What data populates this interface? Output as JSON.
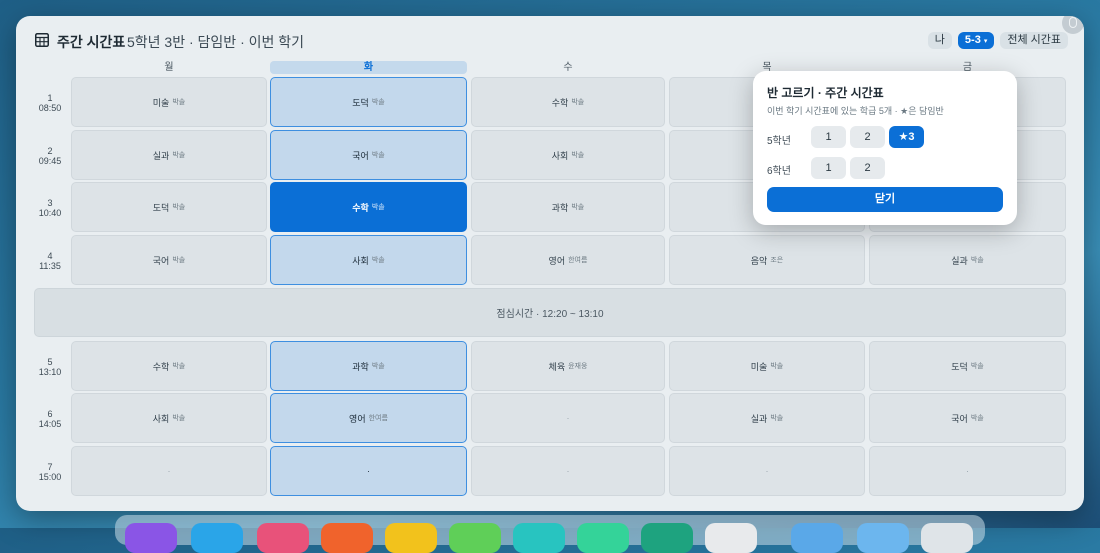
{
  "header": {
    "title": "주간 시간표",
    "subtitle": "5학년 3반 · 담임반 · 이번 학기",
    "me_label": "나",
    "class_label": "5-3",
    "class_caret": "▾",
    "all_label": "전체 시간표"
  },
  "days": [
    "월",
    "화",
    "수",
    "목",
    "금"
  ],
  "periods": [
    {
      "num": "1",
      "time": "08:50"
    },
    {
      "num": "2",
      "time": "09:45"
    },
    {
      "num": "3",
      "time": "10:40"
    },
    {
      "num": "4",
      "time": "11:35"
    },
    {
      "num": "5",
      "time": "13:10"
    },
    {
      "num": "6",
      "time": "14:05"
    },
    {
      "num": "7",
      "time": "15:00"
    }
  ],
  "lunch": "점심시간 · 12:20 ~ 13:10",
  "grid": [
    [
      {
        "s": "미술",
        "t": "박솔"
      },
      {
        "s": "도덕",
        "t": "박솔"
      },
      {
        "s": "수학",
        "t": "박솔"
      },
      {
        "s": "",
        "t": ""
      },
      {
        "s": "",
        "t": ""
      }
    ],
    [
      {
        "s": "실과",
        "t": "박솔"
      },
      {
        "s": "국어",
        "t": "박솔"
      },
      {
        "s": "사회",
        "t": "박솔"
      },
      {
        "s": "",
        "t": ""
      },
      {
        "s": "",
        "t": ""
      }
    ],
    [
      {
        "s": "도덕",
        "t": "박솔"
      },
      {
        "s": "수학",
        "t": "박솔"
      },
      {
        "s": "과학",
        "t": "박솔"
      },
      {
        "s": "",
        "t": ""
      },
      {
        "s": "",
        "t": ""
      }
    ],
    [
      {
        "s": "국어",
        "t": "박솔"
      },
      {
        "s": "사회",
        "t": "박솔"
      },
      {
        "s": "영어",
        "t": "한여름"
      },
      {
        "s": "음악",
        "t": "조은"
      },
      {
        "s": "실과",
        "t": "박솔"
      }
    ],
    [
      {
        "s": "수학",
        "t": "박솔"
      },
      {
        "s": "과학",
        "t": "박솔"
      },
      {
        "s": "체육",
        "t": "윤재웅"
      },
      {
        "s": "미술",
        "t": "박솔"
      },
      {
        "s": "도덕",
        "t": "박솔"
      }
    ],
    [
      {
        "s": "사회",
        "t": "박솔"
      },
      {
        "s": "영어",
        "t": "한여름"
      },
      {
        "s": "·",
        "t": ""
      },
      {
        "s": "실과",
        "t": "박솔"
      },
      {
        "s": "국어",
        "t": "박솔"
      }
    ],
    [
      {
        "s": "·",
        "t": ""
      },
      {
        "s": "·",
        "t": ""
      },
      {
        "s": "·",
        "t": ""
      },
      {
        "s": "·",
        "t": ""
      },
      {
        "s": "·",
        "t": ""
      }
    ]
  ],
  "popup": {
    "title": "반 고르기 · 주간 시간표",
    "subtitle": "이번 학기 시간표에 있는 학급 5개 · ★은 담임반",
    "grade5": "5학년",
    "grade6": "6학년",
    "g5_buttons": [
      "1",
      "2",
      "★3"
    ],
    "g6_buttons": [
      "1",
      "2"
    ],
    "close": "닫기"
  },
  "colors": {
    "accent": "#0b6fd6",
    "dock": [
      "#8a55e6",
      "#2aa5e8",
      "#e8527a",
      "#f0632c",
      "#f2c21c",
      "#5fcf58",
      "#28c4c0",
      "#34d399",
      "#1ea37f",
      "#e8eaec",
      "#5aa8e8",
      "#6cb6ee",
      "#dfe4e8"
    ]
  }
}
